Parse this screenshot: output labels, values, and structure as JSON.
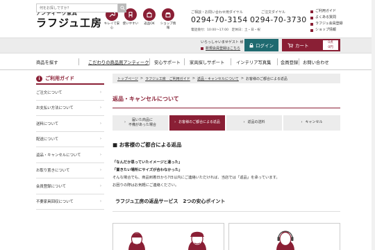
{
  "header": {
    "logo_sub": "アンティーク家具",
    "logo_main": "ラフジュ工房",
    "features": [
      {
        "label1": "キレイで安",
        "label2": "心",
        "icon": "wrench-icon"
      },
      {
        "label1": "使いやすい",
        "label2": "",
        "icon": "chair-icon"
      },
      {
        "label1": "返品OK",
        "label2": "",
        "icon": "box-icon"
      },
      {
        "label1": "ショップ情",
        "label2": "報",
        "icon": "shop-icon"
      }
    ],
    "tel1_caption": "ご相談・お問い合わせ用ダイヤル",
    "tel1_number": "0294-70-3154",
    "tel2_caption": "ご注文ダイヤル",
    "tel2_number": "0294-70-3730",
    "hours": "電話受付：10:00～17:00　定休日：土・日・祝",
    "guide_links": [
      "ご利用ガイド",
      "よくある質問",
      "ラフジュ会員登録",
      "ショップ情報"
    ]
  },
  "search": {
    "placeholder": "何をお探しですか？",
    "greeting": "いらっしゃいませゲスト 様",
    "register": "新規会員登録はこちら",
    "login": "ログイン",
    "cart": "カート",
    "cart_count_1": "0点",
    "cart_count_2": "0円"
  },
  "nav": {
    "items": [
      "商品を探す",
      "こだわりの商品買アンティーク",
      "安心サポート",
      "家具探しサポート",
      "インテリア写真集",
      "会員登録",
      "お問い合わせ"
    ]
  },
  "sidebar": {
    "title": "ご利用ガイド",
    "items": [
      "ご注文について",
      "お支払い方法について",
      "送料について",
      "配送について",
      "返品・キャンセルについて",
      "お取り置きについて",
      "会員登録について",
      "不要家具回収について"
    ]
  },
  "breadcrumb": {
    "items": [
      "トップページ",
      "ラフジュ工房　ご利用ガイド",
      "返品・キャンセルについて",
      "お客様のご都合による返品"
    ],
    "sep": ">"
  },
  "main": {
    "title": "返品・キャンセルについて",
    "tabs": [
      {
        "line1": "届いた商品に",
        "line2": "不備があった場合"
      },
      {
        "line1": "お客様のご都合による返品",
        "line2": ""
      },
      {
        "line1": "返品の送料",
        "line2": ""
      },
      {
        "line1": "キャンセル",
        "line2": ""
      }
    ],
    "section_title": "■ お客様のご都合による返品",
    "quote1": "「なんだか思っていたイメージと違った」",
    "quote2": "「置きたい場所にサイズが合わなかった」",
    "para1": "そんな場合でも、商品到着日から7日以内にご連絡いただければ、当店では「返品」を承っています。",
    "para2": "お困りの際はお気軽にご連絡ください。",
    "points_title": "ラフジュ工房の返品サービス　2つの安心ポイント"
  },
  "colors": {
    "brand": "#8a1f35",
    "teal": "#1f6a70"
  }
}
